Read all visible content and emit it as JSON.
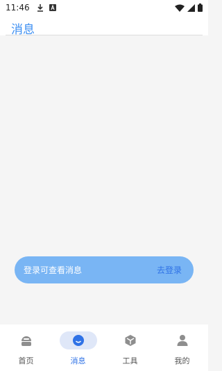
{
  "status_bar": {
    "time": "11:46",
    "left_icons": [
      "download-icon",
      "a-badge-icon"
    ],
    "right_icons": [
      "wifi-icon",
      "signal-icon",
      "battery-icon"
    ]
  },
  "header": {
    "title": "消息"
  },
  "toast": {
    "message": "登录可查看消息",
    "action_label": "去登录",
    "background_color": "#79b5f4",
    "action_color": "#2f72e6"
  },
  "tabs": [
    {
      "label": "首页",
      "icon": "home-icon",
      "active": false
    },
    {
      "label": "消息",
      "icon": "message-icon",
      "active": true
    },
    {
      "label": "工具",
      "icon": "tools-cube-icon",
      "active": false
    },
    {
      "label": "我的",
      "icon": "profile-icon",
      "active": false
    }
  ],
  "colors": {
    "accent": "#2f72e6",
    "title": "#3b8ef2",
    "active_tab_bg": "#dfe7f8"
  }
}
